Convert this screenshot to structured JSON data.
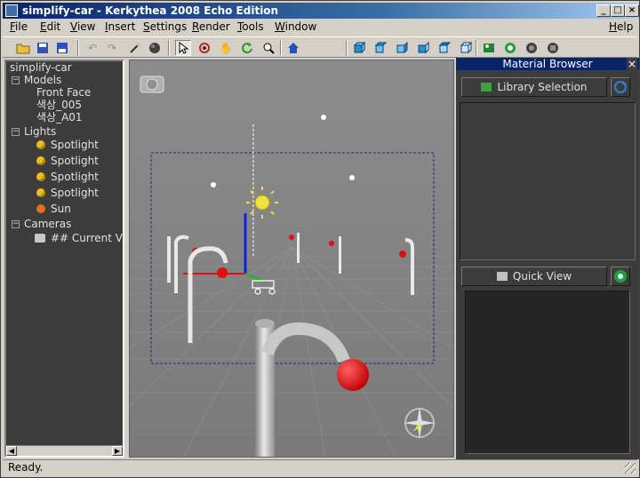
{
  "window": {
    "title": "simplify-car - Kerkythea 2008 Echo Edition"
  },
  "menu": {
    "items": [
      {
        "label": "File",
        "key": "F",
        "rest": "ile"
      },
      {
        "label": "Edit",
        "key": "E",
        "rest": "dit"
      },
      {
        "label": "View",
        "key": "V",
        "rest": "iew"
      },
      {
        "label": "Insert",
        "key": "I",
        "rest": "nsert"
      },
      {
        "label": "Settings",
        "key": "S",
        "rest": "ettings"
      },
      {
        "label": "Render",
        "key": "R",
        "rest": "ender"
      },
      {
        "label": "Tools",
        "key": "T",
        "rest": "ools"
      },
      {
        "label": "Window",
        "key": "W",
        "rest": "indow"
      }
    ],
    "help": {
      "label": "Help",
      "key": "H",
      "rest": "elp"
    }
  },
  "toolbar": {
    "icons": [
      "open-icon",
      "save-icon",
      "save-as-icon",
      "undo-icon",
      "redo-icon",
      "render-icon",
      "sphere-icon",
      "select-icon",
      "orbit-icon",
      "pan-icon",
      "rotate-icon",
      "zoom-icon",
      "home-icon",
      "cube-front-icon",
      "cube-back-icon",
      "cube-left-icon",
      "cube-right-icon",
      "cube-top-icon",
      "cube-bottom-icon",
      "scene-icon",
      "globe-icon",
      "globe-settings-icon",
      "globe-stop-icon"
    ]
  },
  "tree": {
    "root": "simplify-car",
    "models_label": "Models",
    "models": [
      "Front Face",
      "색상_005",
      "색상_A01"
    ],
    "lights_label": "Lights",
    "lights": [
      "Spotlight",
      "Spotlight",
      "Spotlight",
      "Spotlight"
    ],
    "sun_label": "Sun",
    "cameras_label": "Cameras",
    "camera_item": "## Current View"
  },
  "material_browser": {
    "title": "Material Browser",
    "library_button": "Library Selection",
    "quick_view_button": "Quick View"
  },
  "status": {
    "text": "Ready."
  },
  "colors": {
    "title_start": "#0a246a",
    "lamp_red": "#e01010",
    "axis_blue": "#1020e0",
    "axis_red": "#e01010",
    "axis_green": "#10c010",
    "sun_yellow": "#f0e040"
  }
}
